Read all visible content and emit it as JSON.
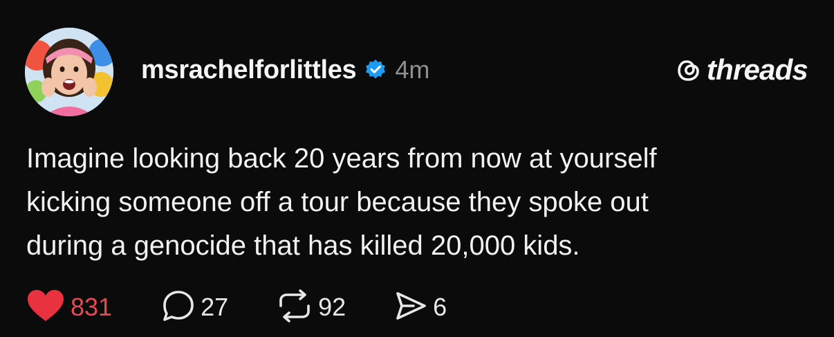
{
  "post": {
    "author": {
      "username": "msrachelforlittles",
      "verified": true,
      "avatar_icon": "profile-photo"
    },
    "timestamp": "4m",
    "brand": {
      "name": "threads",
      "icon": "threads-logo-icon"
    },
    "text_lines": [
      "Imagine looking back 20 years from now at yourself",
      "kicking someone off a tour because they spoke out",
      "during a genocide that has killed 20,000 kids."
    ],
    "actions": {
      "likes": {
        "count": "831",
        "icon": "heart-icon",
        "liked": true
      },
      "replies": {
        "count": "27",
        "icon": "comment-icon"
      },
      "reposts": {
        "count": "92",
        "icon": "repost-icon"
      },
      "shares": {
        "count": "6",
        "icon": "send-icon"
      }
    }
  },
  "colors": {
    "background": "#0b0b0b",
    "text": "#f2f2f2",
    "muted": "#8f8f8f",
    "like": "#e64a55",
    "verified": "#1d9bf0"
  }
}
